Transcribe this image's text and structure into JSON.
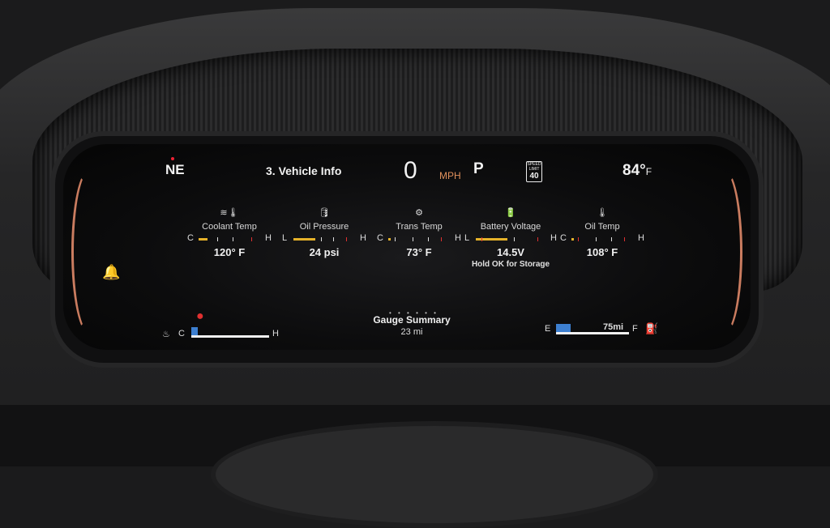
{
  "header": {
    "compass": "NE",
    "title": "3. Vehicle Info",
    "speed": "0",
    "speed_unit": "MPH",
    "gear": "P",
    "speed_limit": {
      "top": "SPEED LIMIT",
      "value": "40"
    },
    "outside_temp": "84°",
    "outside_temp_unit": "F"
  },
  "gauges": [
    {
      "icon": "coolant-icon",
      "label": "Coolant Temp",
      "low": "C",
      "high": "H",
      "value": "120° F",
      "level": 0.15
    },
    {
      "icon": "oil-can-icon",
      "label": "Oil Pressure",
      "low": "L",
      "high": "H",
      "value": "24 psi",
      "level": 0.35
    },
    {
      "icon": "transmission-icon",
      "label": "Trans Temp",
      "low": "C",
      "high": "H",
      "value": "73° F",
      "level": 0.0
    },
    {
      "icon": "battery-icon",
      "label": "Battery Voltage",
      "low": "L",
      "high": "H",
      "value": "14.5V",
      "note": "Hold OK for Storage",
      "level": 0.45
    },
    {
      "icon": "oil-temp-icon",
      "label": "Oil Temp",
      "low": "C",
      "high": "H",
      "value": "108° F",
      "level": 0.0
    }
  ],
  "page_dots": "• • • • • •",
  "summary": {
    "label": "Gauge Summary",
    "distance": "23 mi"
  },
  "coolant_bottom": {
    "low": "C",
    "high": "H"
  },
  "fuel": {
    "low": "E",
    "high": "F",
    "range": "75mi"
  },
  "colors": {
    "accent": "#e0905c",
    "gauge_fill": "#e6b22a",
    "warning": "#e03030",
    "bar_blue": "#3d7fd0"
  }
}
